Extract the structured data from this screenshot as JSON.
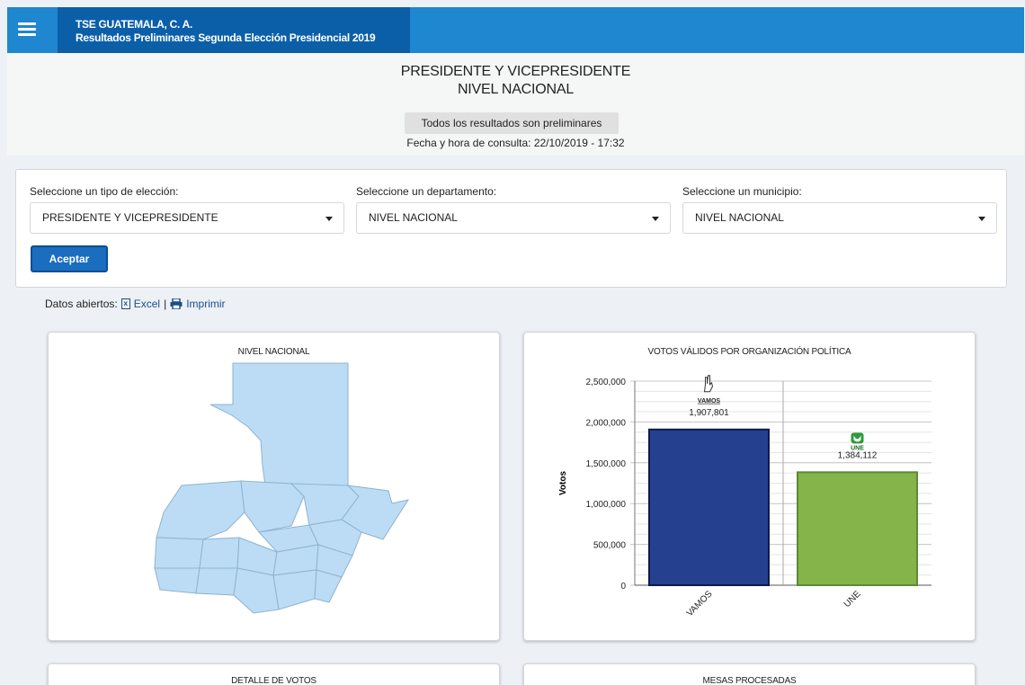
{
  "header": {
    "org": "TSE GUATEMALA, C. A.",
    "subtitle": "Resultados Preliminares Segunda Elección Presidencial 2019",
    "color": "#1f86d0",
    "brand_color": "#0b5fa9"
  },
  "page": {
    "title_line1": "PRESIDENTE Y VICEPRESIDENTE",
    "title_line2": "NIVEL NACIONAL",
    "preliminary_note": "Todos los resultados son preliminares",
    "consulta": "Fecha y hora de consulta: 22/10/2019 - 17:32"
  },
  "filters": {
    "election_label": "Seleccione un tipo de elección:",
    "election_value": "PRESIDENTE Y VICEPRESIDENTE",
    "department_label": "Seleccione un departamento:",
    "department_value": "NIVEL NACIONAL",
    "municipality_label": "Seleccione un municipio:",
    "municipality_value": "NIVEL NACIONAL",
    "accept_label": "Aceptar"
  },
  "open_data": {
    "label": "Datos abiertos:",
    "excel": "Excel",
    "separator": "|",
    "print": "Imprimir"
  },
  "map_card": {
    "title": "NIVEL NACIONAL",
    "fill_color": "#bcdcf5"
  },
  "chart_card": {
    "title": "VOTOS VÁLIDOS POR ORGANIZACIÓN POLÍTICA"
  },
  "bottom_cards": {
    "detail_title": "DETALLE DE VOTOS",
    "mesas_title": "MESAS PROCESADAS"
  },
  "chart_data": {
    "type": "bar",
    "title": "VOTOS VÁLIDOS POR ORGANIZACIÓN POLÍTICA",
    "categories": [
      "VAMOS",
      "UNE"
    ],
    "values": [
      1907801,
      1384112
    ],
    "value_labels": [
      "1,907,801",
      "1,384,112"
    ],
    "logo_labels": [
      "VAMOS",
      "UNE"
    ],
    "colors": [
      "#25408f",
      "#84b44a"
    ],
    "ylabel": "Votos",
    "xlabel": "",
    "ylim": [
      0,
      2500000
    ],
    "yticks": [
      0,
      500000,
      1000000,
      1500000,
      2000000,
      2500000
    ],
    "ytick_labels": [
      "0",
      "500,000",
      "1,000,000",
      "1,500,000",
      "2,000,000",
      "2,500,000"
    ],
    "grid": true
  }
}
